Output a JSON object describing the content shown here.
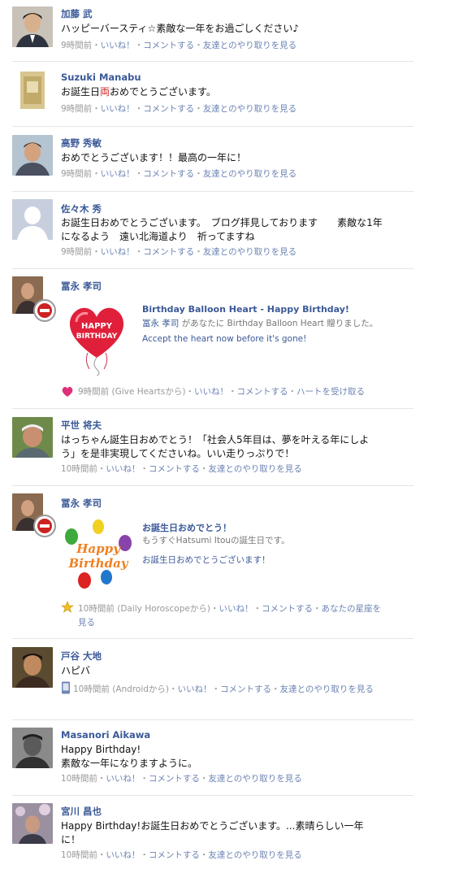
{
  "posts": [
    {
      "name": "加藤 武",
      "message": "ハッピーバースティ☆素敵な一年をお過ごしください♪",
      "time": "9時間前",
      "like": "いいね！",
      "comment": "コメントする",
      "extra": "友達とのやり取りを見る"
    },
    {
      "name": "Suzuki Manabu",
      "message": "お誕生日",
      "message_char": "両",
      "message_tail": "おめでとうございます。",
      "time": "9時間前",
      "like": "いいね！",
      "comment": "コメントする",
      "extra": "友達とのやり取りを見る"
    },
    {
      "name": "高野 秀敏",
      "message": "おめでとうございます！！最高の一年に！",
      "time": "9時間前",
      "like": "いいね！",
      "comment": "コメントする",
      "extra": "友達とのやり取りを見る"
    },
    {
      "name": "佐々木 秀",
      "message": "お誕生日おめでとうございます。　ブログ拝見しております　　素敵な1年になるよう　遠い北海道より　祈ってますね",
      "time": "9時間前",
      "like": "いいね！",
      "comment": "コメントする",
      "extra": "友達とのやり取りを見る"
    },
    {
      "name": "冨永 孝司",
      "app_title": "Birthday Balloon Heart - Happy Birthday!",
      "app_sub_name": "冨永 孝司",
      "app_sub_text": "があなたに Birthday Balloon Heart 贈りました。",
      "app_link": "Accept the heart now before it's gone!",
      "time": "9時間前",
      "via": "(Give Heartsから)",
      "like": "いいね！",
      "comment": "コメントする",
      "extra": "ハートを受け取る"
    },
    {
      "name": "平世 将夫",
      "message": "はっちゃん誕生日おめでとう！「社会人5年目は、夢を叶える年にしよう」を是非実現してくださいね。いい走りっぷりで！",
      "time": "10時間前",
      "like": "いいね！",
      "comment": "コメントする",
      "extra": "友達とのやり取りを見る"
    },
    {
      "name": "冨永 孝司",
      "app_title": "お誕生日おめでとう！",
      "app_sub_text": "もうすぐHatsumi Itouの誕生日です。",
      "app_link": "お誕生日おめでとうございます！",
      "time": "10時間前",
      "via": "(Daily Horoscopeから)",
      "like": "いいね！",
      "comment": "コメントする",
      "extra": "あなたの星座を見る"
    },
    {
      "name": "戸谷 大地",
      "message": "ハピバ",
      "time": "10時間前",
      "via": "(Androidから)",
      "like": "いいね！",
      "comment": "コメントする",
      "extra": "友達とのやり取りを見る"
    },
    {
      "name": "Masanori Aikawa",
      "message_line1": "Happy Birthday!",
      "message_line2": "素敵な一年になりますように。",
      "time": "10時間前",
      "like": "いいね！",
      "comment": "コメントする",
      "extra": "友達とのやり取りを見る"
    },
    {
      "name": "宮川 昌也",
      "message": "Happy Birthday!お誕生日おめでとうございます。...素晴らしい一年に！",
      "time": "10時間前",
      "like": "いいね！",
      "comment": "コメントする",
      "extra": "友達とのやり取りを見る"
    }
  ],
  "separator": "・",
  "colors": {
    "name_blue": "#3b5998",
    "link_blue": "#6d84b4",
    "meta_gray": "#999999",
    "divider": "#e5e5e5"
  },
  "icons": {
    "heart": "heart-icon",
    "star": "star-icon",
    "phone": "mobile-phone-icon",
    "balloon_heart": "balloon-heart-icon",
    "happy_birthday": "happy-birthday-balloons-icon"
  }
}
